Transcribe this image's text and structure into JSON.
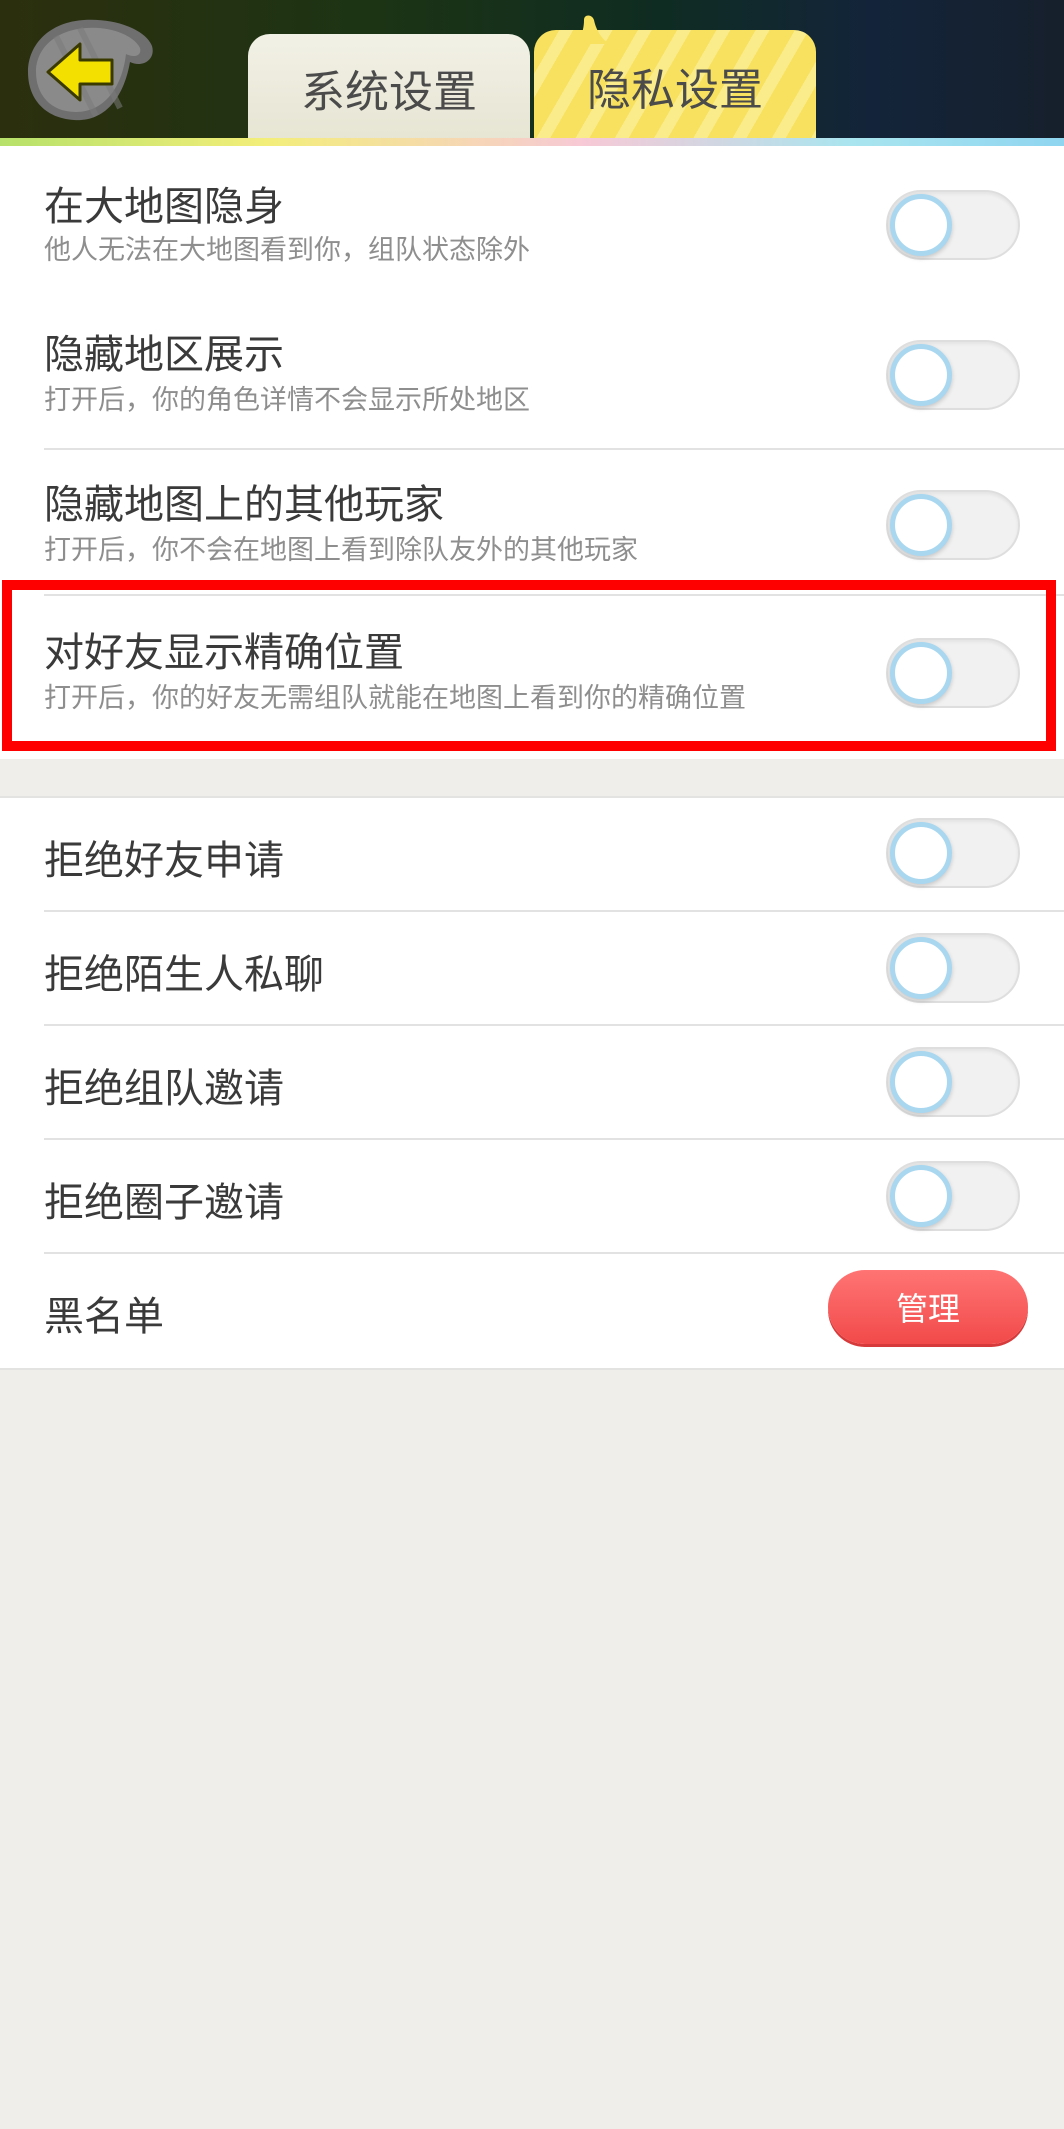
{
  "header": {
    "tabs": [
      {
        "label": "系统设置",
        "active": false
      },
      {
        "label": "隐私设置",
        "active": true
      }
    ]
  },
  "privacy_settings": [
    {
      "title": "在大地图隐身",
      "subtitle": "他人无法在大地图看到你，组队状态除外",
      "enabled": false
    },
    {
      "title": "隐藏地区展示",
      "subtitle": "打开后，你的角色详情不会显示所处地区",
      "enabled": false
    },
    {
      "title": "隐藏地图上的其他玩家",
      "subtitle": "打开后，你不会在地图上看到除队友外的其他玩家",
      "enabled": false
    },
    {
      "title": "对好友显示精确位置",
      "subtitle": "打开后，你的好友无需组队就能在地图上看到你的精确位置",
      "enabled": false
    }
  ],
  "reject_settings": [
    {
      "title": "拒绝好友申请",
      "enabled": false
    },
    {
      "title": "拒绝陌生人私聊",
      "enabled": false
    },
    {
      "title": "拒绝组队邀请",
      "enabled": false
    },
    {
      "title": "拒绝圈子邀请",
      "enabled": false
    }
  ],
  "blacklist": {
    "title": "黑名单",
    "button_label": "管理"
  },
  "colors": {
    "active_tab": "#f7e15e",
    "toggle_knob_ring": "#a9d7f0",
    "manage_button": "#f24a4a",
    "highlight_box": "#ff0000"
  },
  "icons": {
    "back": "back-arrow-icon"
  }
}
